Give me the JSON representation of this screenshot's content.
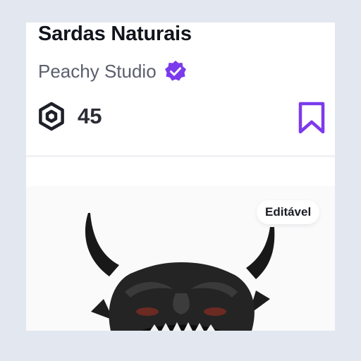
{
  "item": {
    "name": "Sardas Naturais",
    "creator": "Peachy Studio",
    "creator_verified": true,
    "price": "45",
    "currency_icon": "robux-icon",
    "badge": "Editável"
  },
  "colors": {
    "background": "#e3e8f0",
    "card": "#ffffff",
    "accent": "#7c3aed",
    "title": "#12141d",
    "creator_text": "#5b5f6d"
  },
  "icons": {
    "verified": "verified-badge-icon",
    "bookmark": "bookmark-icon",
    "item": "oni-mask-image"
  }
}
